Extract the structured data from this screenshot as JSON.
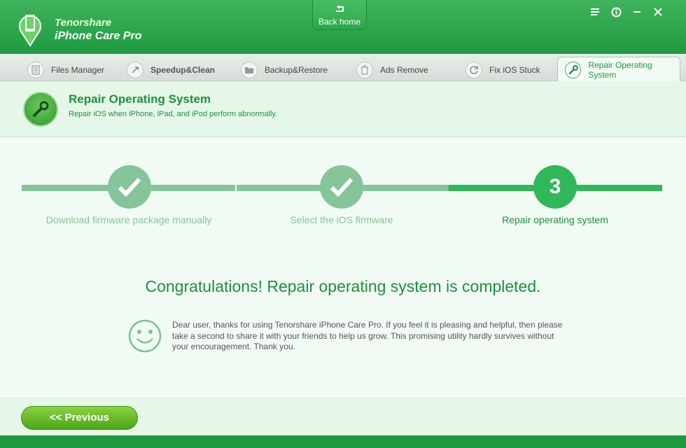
{
  "app": {
    "brand_top": "Tenorshare",
    "brand_bottom": "iPhone Care Pro"
  },
  "header": {
    "back_home": "Back home"
  },
  "tabs": [
    {
      "label": "Files Manager"
    },
    {
      "label": "Speedup&Clean"
    },
    {
      "label": "Backup&Restore"
    },
    {
      "label": "Ads Remove"
    },
    {
      "label": "Fix iOS Stuck"
    },
    {
      "label": "Repair Operating System",
      "active": true
    }
  ],
  "section": {
    "title": "Repair Operating System",
    "subtitle": "Repair iOS when iPhone, iPad, and iPod perform abnormally."
  },
  "steps": [
    {
      "label": "Download firmware package manually",
      "state": "done"
    },
    {
      "label": "Select the iOS firmware",
      "state": "done"
    },
    {
      "label": "Repair operating system",
      "state": "current",
      "number": "3"
    }
  ],
  "result": {
    "headline": "Congratulations! Repair operating system is completed.",
    "message": "Dear user, thanks for using Tenorshare iPhone Care Pro. If you feel it is pleasing and helpful, then please take a second to share it with your friends to help us grow. This promising utility hardly survives without your encouragement. Thank you."
  },
  "footer": {
    "previous": "<< Previous"
  },
  "colors": {
    "primary": "#1f9a40",
    "done": "#86c49a",
    "current": "#2fb85a"
  }
}
